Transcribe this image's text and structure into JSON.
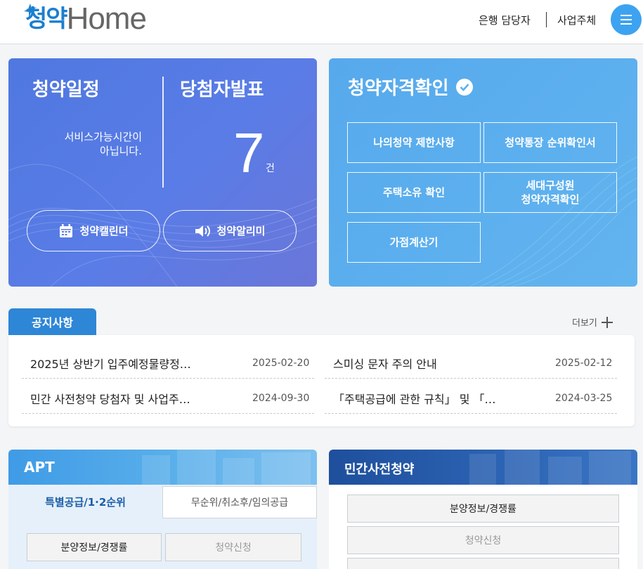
{
  "header": {
    "logo_kr": "청약",
    "logo_en": "Home",
    "bank_link": "은행 담당자",
    "biz_link": "사업주체",
    "menu_icon": "hamburger-icon"
  },
  "schedule": {
    "title": "청약일정",
    "message_line1": "서비스가능시간이",
    "message_line2": "아닙니다.",
    "calendar_button": "청약캘린더",
    "alarm_button": "청약알리미"
  },
  "winners": {
    "title": "당첨자발표",
    "count": "7",
    "unit": "건"
  },
  "eligibility": {
    "title": "청약자격확인",
    "buttons": [
      {
        "label": "나의청약 제한사항"
      },
      {
        "label": "청약통장 순위확인서"
      },
      {
        "label": "주택소유 확인"
      },
      {
        "label_line1": "세대구성원",
        "label_line2": "청약자격확인"
      },
      {
        "label": "가점계산기"
      }
    ]
  },
  "notice": {
    "tab": "공지사항",
    "more": "더보기",
    "items": [
      {
        "title": "2025년 상반기 입주예정물량정…",
        "date": "2025-02-20"
      },
      {
        "title": "스미싱 문자 주의 안내",
        "date": "2025-02-12"
      },
      {
        "title": "민간 사전청약 당첨자 및 사업주…",
        "date": "2024-09-30"
      },
      {
        "title": "「주택공급에 관한 규칙」 및 「…",
        "date": "2024-03-25"
      }
    ]
  },
  "apt": {
    "title": "APT",
    "tab_active": "특별공급/1·2순위",
    "tab_other": "무순위/취소후/임의공급",
    "btn_info": "분양정보/경쟁률",
    "btn_apply": "청약신청"
  },
  "pre": {
    "title": "민간사전청약",
    "btn_info": "분양정보/경쟁률",
    "btn_apply": "청약신청"
  },
  "colors": {
    "brand_blue": "#1b7fd0",
    "schedule_card": "#5a7ce6",
    "eligibility_card": "#5db0ee",
    "notice_tab": "#2e86d6"
  }
}
